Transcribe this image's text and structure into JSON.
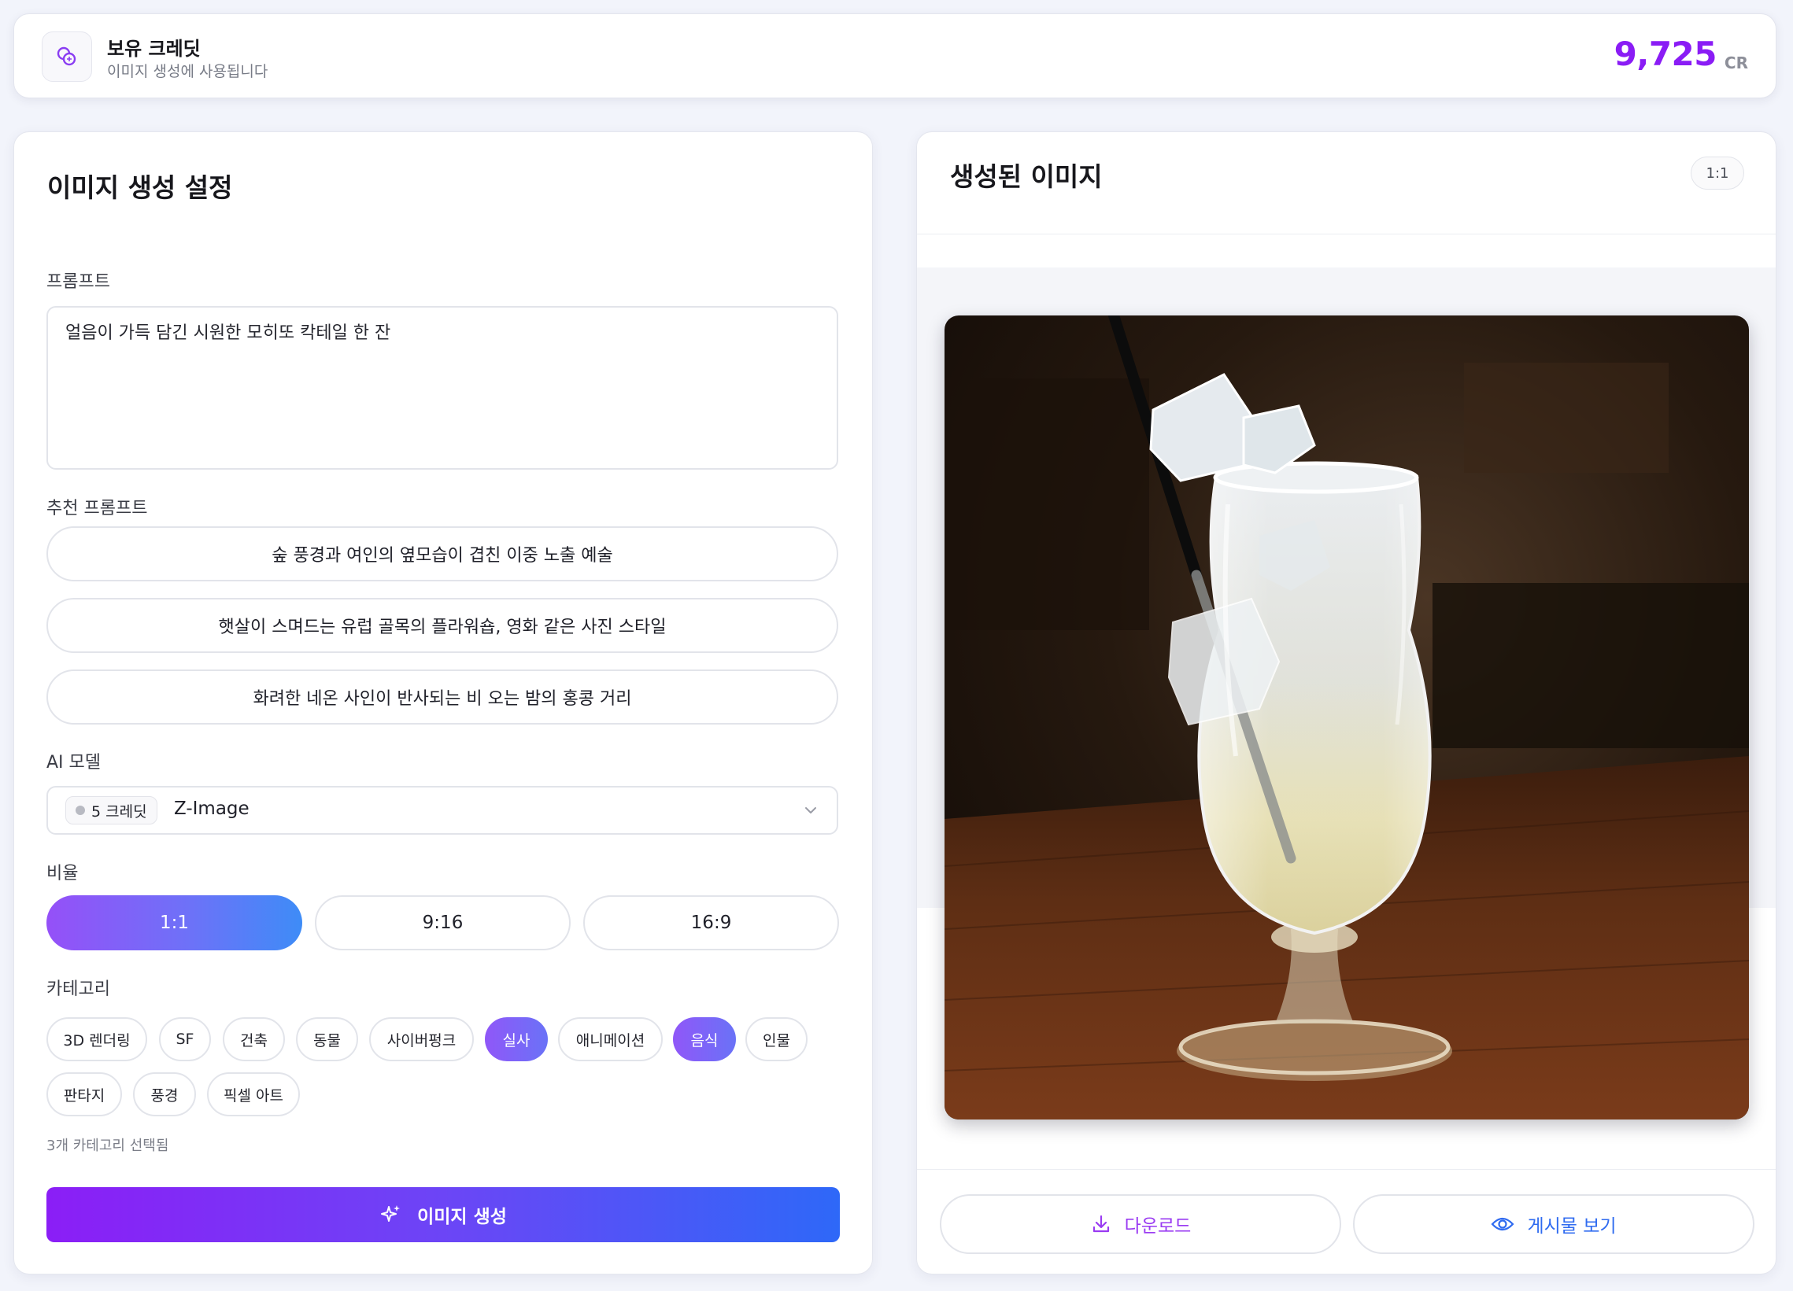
{
  "credits": {
    "title": "보유 크레딧",
    "subtitle": "이미지 생성에 사용됩니다",
    "amount": "9,725",
    "unit": "CR"
  },
  "settings": {
    "title": "이미지 생성 설정",
    "prompt_label": "프롬프트",
    "prompt_value": "얼음이 가득 담긴 시원한 모히또 칵테일 한 잔",
    "suggest_label": "추천 프롬프트",
    "suggestions": [
      "숲 풍경과 여인의 옆모습이 겹친 이중 노출 예술",
      "햇살이 스며드는 유럽 골목의 플라워숍, 영화 같은 사진 스타일",
      "화려한 네온 사인이 반사되는 비 오는 밤의 홍콩 거리"
    ],
    "model_label": "AI 모델",
    "model_cost": "5 크레딧",
    "model_name": "Z-Image",
    "ratio_label": "비율",
    "ratios": [
      "1:1",
      "9:16",
      "16:9"
    ],
    "selected_ratio": "1:1",
    "category_label": "카테고리",
    "categories": [
      "3D 렌더링",
      "SF",
      "건축",
      "동물",
      "사이버펑크",
      "실사",
      "애니메이션",
      "음식",
      "인물",
      "판타지",
      "풍경",
      "픽셀 아트"
    ],
    "selected_categories": [
      "실사",
      "음식"
    ],
    "selected_count_text": "3개 카테고리 선택됨",
    "generate_label": "이미지 생성"
  },
  "result": {
    "title": "생성된 이미지",
    "ratio_tag": "1:1",
    "download_label": "다운로드",
    "view_post_label": "게시물 보기"
  },
  "colors": {
    "accent_purple": "#8a1cf5",
    "accent_blue": "#2e68f8",
    "background": "#f2f4fb"
  },
  "icons": {
    "credit": "coins-icon",
    "model_dropdown": "chevron-down-icon",
    "generate": "sparkle-icon",
    "download": "download-icon",
    "view_post": "eye-icon"
  }
}
